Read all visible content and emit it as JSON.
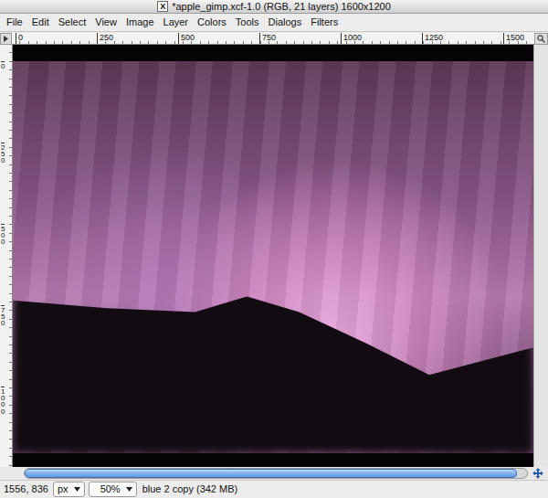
{
  "window": {
    "title": "*apple_gimp.xcf-1.0 (RGB, 21 layers) 1600x1200",
    "logo": "X"
  },
  "menu": [
    "File",
    "Edit",
    "Select",
    "View",
    "Image",
    "Layer",
    "Colors",
    "Tools",
    "Dialogs",
    "Filters"
  ],
  "ruler_top": {
    "ticks": [
      "0",
      "250",
      "500",
      "750",
      "1000",
      "1250",
      "1500"
    ]
  },
  "ruler_left": {
    "ticks": [
      "0",
      "250",
      "500",
      "750",
      "1000"
    ]
  },
  "horizontal_scrollbar": {
    "level": 0.98
  },
  "status_bar": {
    "coords": "1556, 836",
    "unit": "px",
    "zoom": "50%",
    "message": "blue 2 copy (342 MB)"
  }
}
